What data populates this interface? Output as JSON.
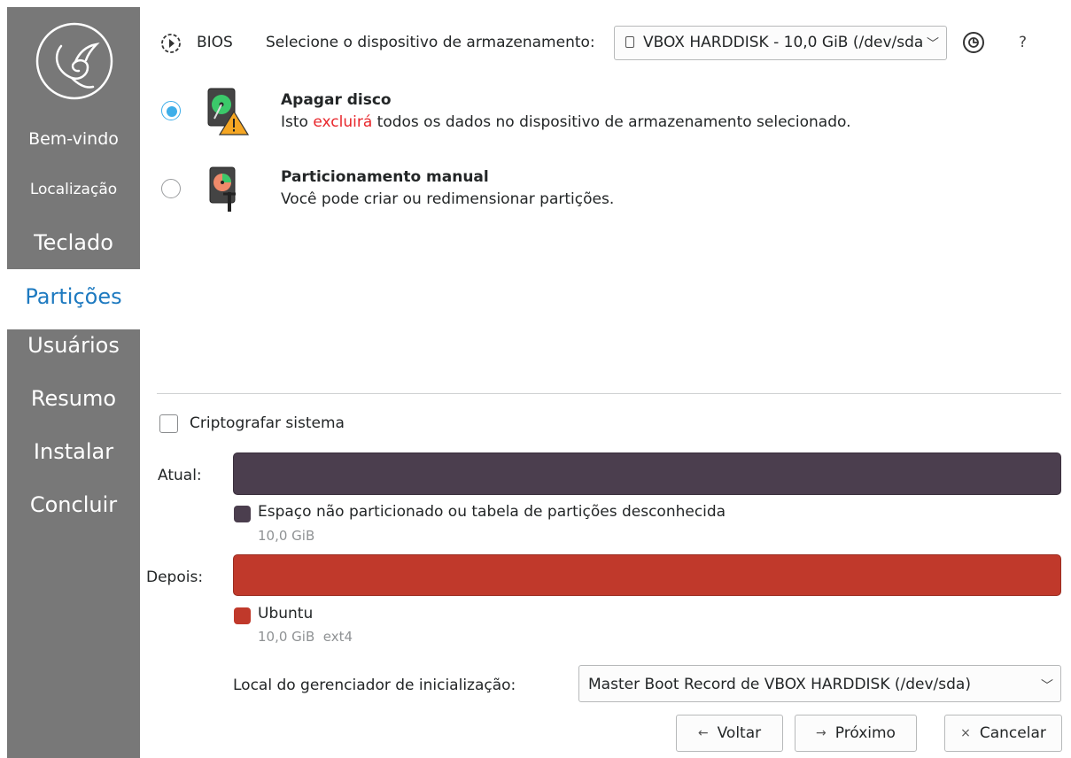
{
  "sidebar": {
    "items": [
      {
        "label": "Bem-vindo"
      },
      {
        "label": "Localização"
      },
      {
        "label": "Teclado"
      },
      {
        "label": "Partições"
      },
      {
        "label": "Usuários"
      },
      {
        "label": "Resumo"
      },
      {
        "label": "Instalar"
      },
      {
        "label": "Concluir"
      }
    ],
    "active_index": 3,
    "active_color": "#1e7ac0"
  },
  "header": {
    "firmware_label": "BIOS",
    "device_prompt": "Selecione o dispositivo de armazenamento:",
    "device_selected": "VBOX HARDDISK - 10,0 GiB (/dev/sda)",
    "help_label": "?"
  },
  "options": {
    "erase": {
      "title": "Apagar disco",
      "desc_before": "Isto ",
      "desc_warning": "excluirá",
      "desc_after": " todos os dados no dispositivo de armazenamento selecionado.",
      "selected": true
    },
    "manual": {
      "title": "Particionamento manual",
      "desc": "Você pode criar ou redimensionar partições.",
      "selected": false
    }
  },
  "encrypt": {
    "label": "Criptografar sistema",
    "checked": false
  },
  "current": {
    "label": "Atual:",
    "legend_name": "Espaço não particionado ou tabela de partições desconhecida",
    "legend_size": "10,0 GiB",
    "color": "#4b3e4e"
  },
  "after": {
    "label": "Depois:",
    "legend_name": "Ubuntu",
    "legend_size": "10,0 GiB  ext4",
    "color": "#c0392b"
  },
  "bootloader": {
    "label": "Local do gerenciador de inicialização:",
    "selected": "Master Boot Record de VBOX HARDDISK (/dev/sda)"
  },
  "buttons": {
    "back": "Voltar",
    "next": "Próximo",
    "cancel": "Cancelar"
  },
  "colors": {
    "accent": "#3daee9",
    "warning_text": "#e8262b",
    "sidebar_bg": "#787878"
  }
}
